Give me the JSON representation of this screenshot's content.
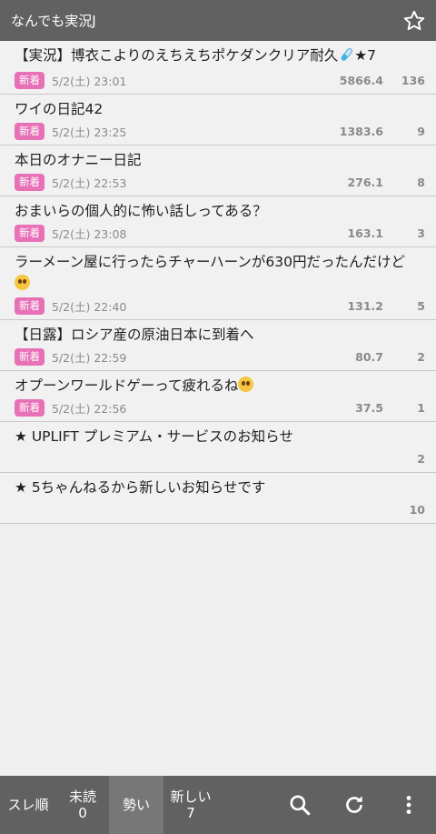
{
  "header": {
    "title": "なんでも実況J",
    "star_icon": "star-outline-icon"
  },
  "threads": [
    {
      "title": "【実況】博衣こよりのえちえちポケダンクリア耐久",
      "suffix": "★7",
      "emoji": "test-tube",
      "badge": "新着",
      "date": "5/2(土) 23:01",
      "ikioi": "5866.4",
      "count": "136"
    },
    {
      "title": "ワイの日記42",
      "badge": "新着",
      "date": "5/2(土) 23:25",
      "ikioi": "1383.6",
      "count": "9"
    },
    {
      "title": "本日のオナニー日記",
      "badge": "新着",
      "date": "5/2(土) 22:53",
      "ikioi": "276.1",
      "count": "8"
    },
    {
      "title": "おまいらの個人的に怖い話しってある？",
      "badge": "新着",
      "date": "5/2(土) 23:08",
      "ikioi": "163.1",
      "count": "3"
    },
    {
      "title": "ラーメーン屋に行ったらチャーハーンが630円だったんだけど",
      "emoji": "pleading",
      "badge": "新着",
      "date": "5/2(土) 22:40",
      "ikioi": "131.2",
      "count": "5"
    },
    {
      "title": "【日露】ロシア産の原油日本に到着へ",
      "badge": "新着",
      "date": "5/2(土) 22:59",
      "ikioi": "80.7",
      "count": "2"
    },
    {
      "title": "オプーンワールドゲーって疲れるね",
      "emoji": "pleading",
      "badge": "新着",
      "date": "5/2(土) 22:56",
      "ikioi": "37.5",
      "count": "1"
    },
    {
      "title": "★ UPLIFT プレミアム・サービスのお知らせ",
      "count": "2"
    },
    {
      "title": "★ 5ちゃんねるから新しいお知らせです",
      "count": "10"
    }
  ],
  "footer": {
    "sort_label": "スレ順",
    "unread_label": "未読",
    "unread_count": "0",
    "ikioi_label": "勢い",
    "new_label": "新しい",
    "new_count": "7",
    "icons": [
      "search-icon",
      "refresh-icon",
      "more-vert-icon"
    ]
  }
}
